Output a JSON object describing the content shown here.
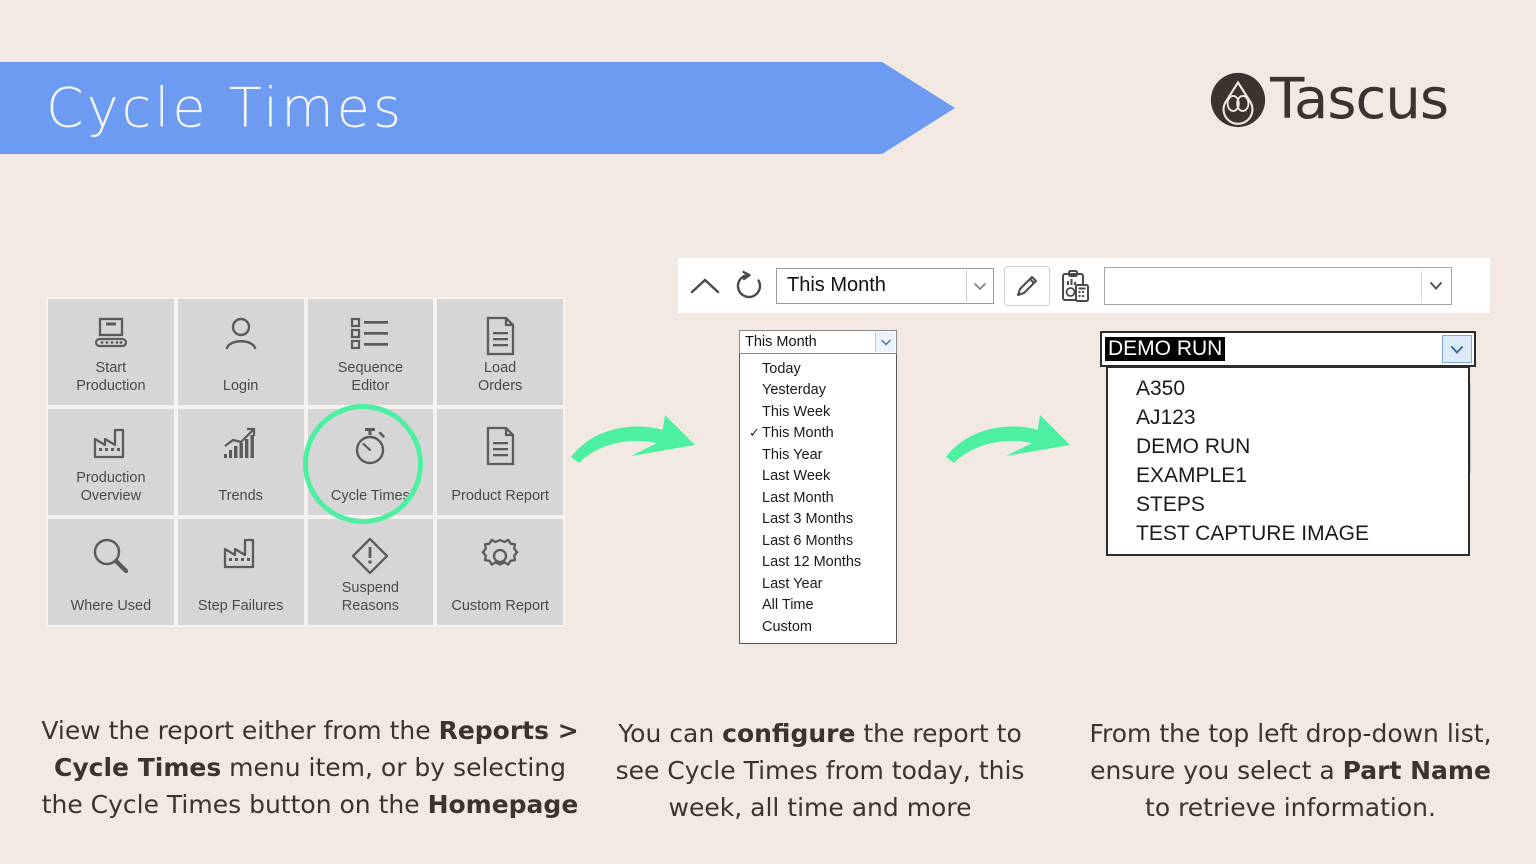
{
  "banner": {
    "title": "Cycle Times",
    "color": "#6D9BF1"
  },
  "logo": {
    "text": "Tascus",
    "mark_icon": "lotus-droplet-logo-icon",
    "color": "#3B3330"
  },
  "background_color": "#F2E9E3",
  "highlight_color": "#4DEFA0",
  "home_grid": {
    "tiles": [
      {
        "label": "Start\nProduction",
        "label_line1": "Start",
        "label_line2": "Production",
        "icon": "conveyor-box-icon"
      },
      {
        "label": "Login",
        "label_line1": "Login",
        "label_line2": "",
        "icon": "user-icon"
      },
      {
        "label": "Sequence Editor",
        "label_line1": "Sequence",
        "label_line2": "Editor",
        "icon": "checklist-icon"
      },
      {
        "label": "Load Orders",
        "label_line1": "Load",
        "label_line2": "Orders",
        "icon": "document-icon"
      },
      {
        "label": "Production Overview",
        "label_line1": "Production",
        "label_line2": "Overview",
        "icon": "factory-icon"
      },
      {
        "label": "Trends",
        "label_line1": "Trends",
        "label_line2": "",
        "icon": "bar-chart-trend-icon"
      },
      {
        "label": "Cycle Times",
        "label_line1": "Cycle Times",
        "label_line2": "",
        "icon": "stopwatch-icon",
        "highlighted": true
      },
      {
        "label": "Product Report",
        "label_line1": "Product Report",
        "label_line2": "",
        "icon": "document-icon"
      },
      {
        "label": "Where Used",
        "label_line1": "Where Used",
        "label_line2": "",
        "icon": "magnifier-icon"
      },
      {
        "label": "Step Failures",
        "label_line1": "Step Failures",
        "label_line2": "",
        "icon": "factory-icon"
      },
      {
        "label": "Suspend Reasons",
        "label_line1": "Suspend",
        "label_line2": "Reasons",
        "icon": "warning-diamond-icon"
      },
      {
        "label": "Custom Report",
        "label_line1": "Custom Report",
        "label_line2": "",
        "icon": "gear-icon"
      }
    ]
  },
  "toolbar": {
    "collapse_icon": "chevron-up-icon",
    "refresh_icon": "refresh-icon",
    "period_value": "This Month",
    "period_caret_icon": "chevron-down-icon",
    "edit_icon": "pencil-icon",
    "report_icon": "clipboard-report-icon",
    "part_value": "",
    "part_caret_icon": "chevron-down-icon"
  },
  "period_dropdown": {
    "selected": "This Month",
    "caret_icon": "chevron-down-icon",
    "check_glyph": "✓",
    "options": [
      "Today",
      "Yesterday",
      "This Week",
      "This Month",
      "This Year",
      "Last Week",
      "Last Month",
      "Last 3 Months",
      "Last 6 Months",
      "Last 12 Months",
      "Last Year",
      "All Time",
      "Custom"
    ]
  },
  "part_dropdown": {
    "selected": "DEMO RUN",
    "caret_icon": "chevron-down-icon",
    "options": [
      "A350",
      "AJ123",
      "DEMO RUN",
      "EXAMPLE1",
      "STEPS",
      "TEST CAPTURE IMAGE"
    ]
  },
  "arrows": [
    {
      "name": "flow-arrow-1",
      "icon": "curved-arrow-right-icon"
    },
    {
      "name": "flow-arrow-2",
      "icon": "curved-arrow-right-icon"
    }
  ],
  "captions": {
    "one": {
      "parts": [
        {
          "text": "View the report either from the ",
          "bold": false
        },
        {
          "text": "Reports > Cycle Times",
          "bold": true
        },
        {
          "text": " menu item, or by selecting the Cycle Times button on the ",
          "bold": false
        },
        {
          "text": "Homepage",
          "bold": true
        }
      ]
    },
    "two": {
      "parts": [
        {
          "text": "You can ",
          "bold": false
        },
        {
          "text": "configure",
          "bold": true
        },
        {
          "text": " the report to see Cycle Times from today, this week, all time and more",
          "bold": false
        }
      ]
    },
    "three": {
      "parts": [
        {
          "text": "From the top left drop-down list, ensure you select a ",
          "bold": false
        },
        {
          "text": "Part Name",
          "bold": true
        },
        {
          "text": " to retrieve information.",
          "bold": false
        }
      ]
    }
  }
}
